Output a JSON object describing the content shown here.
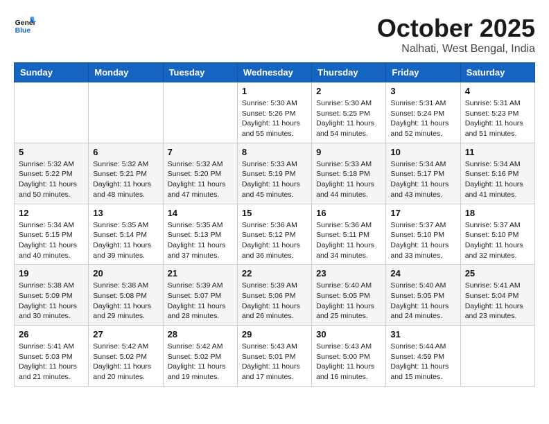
{
  "header": {
    "logo_line1": "General",
    "logo_line2": "Blue",
    "month": "October 2025",
    "location": "Nalhati, West Bengal, India"
  },
  "weekdays": [
    "Sunday",
    "Monday",
    "Tuesday",
    "Wednesday",
    "Thursday",
    "Friday",
    "Saturday"
  ],
  "weeks": [
    [
      {
        "day": "",
        "info": ""
      },
      {
        "day": "",
        "info": ""
      },
      {
        "day": "",
        "info": ""
      },
      {
        "day": "1",
        "info": "Sunrise: 5:30 AM\nSunset: 5:26 PM\nDaylight: 11 hours\nand 55 minutes."
      },
      {
        "day": "2",
        "info": "Sunrise: 5:30 AM\nSunset: 5:25 PM\nDaylight: 11 hours\nand 54 minutes."
      },
      {
        "day": "3",
        "info": "Sunrise: 5:31 AM\nSunset: 5:24 PM\nDaylight: 11 hours\nand 52 minutes."
      },
      {
        "day": "4",
        "info": "Sunrise: 5:31 AM\nSunset: 5:23 PM\nDaylight: 11 hours\nand 51 minutes."
      }
    ],
    [
      {
        "day": "5",
        "info": "Sunrise: 5:32 AM\nSunset: 5:22 PM\nDaylight: 11 hours\nand 50 minutes."
      },
      {
        "day": "6",
        "info": "Sunrise: 5:32 AM\nSunset: 5:21 PM\nDaylight: 11 hours\nand 48 minutes."
      },
      {
        "day": "7",
        "info": "Sunrise: 5:32 AM\nSunset: 5:20 PM\nDaylight: 11 hours\nand 47 minutes."
      },
      {
        "day": "8",
        "info": "Sunrise: 5:33 AM\nSunset: 5:19 PM\nDaylight: 11 hours\nand 45 minutes."
      },
      {
        "day": "9",
        "info": "Sunrise: 5:33 AM\nSunset: 5:18 PM\nDaylight: 11 hours\nand 44 minutes."
      },
      {
        "day": "10",
        "info": "Sunrise: 5:34 AM\nSunset: 5:17 PM\nDaylight: 11 hours\nand 43 minutes."
      },
      {
        "day": "11",
        "info": "Sunrise: 5:34 AM\nSunset: 5:16 PM\nDaylight: 11 hours\nand 41 minutes."
      }
    ],
    [
      {
        "day": "12",
        "info": "Sunrise: 5:34 AM\nSunset: 5:15 PM\nDaylight: 11 hours\nand 40 minutes."
      },
      {
        "day": "13",
        "info": "Sunrise: 5:35 AM\nSunset: 5:14 PM\nDaylight: 11 hours\nand 39 minutes."
      },
      {
        "day": "14",
        "info": "Sunrise: 5:35 AM\nSunset: 5:13 PM\nDaylight: 11 hours\nand 37 minutes."
      },
      {
        "day": "15",
        "info": "Sunrise: 5:36 AM\nSunset: 5:12 PM\nDaylight: 11 hours\nand 36 minutes."
      },
      {
        "day": "16",
        "info": "Sunrise: 5:36 AM\nSunset: 5:11 PM\nDaylight: 11 hours\nand 34 minutes."
      },
      {
        "day": "17",
        "info": "Sunrise: 5:37 AM\nSunset: 5:10 PM\nDaylight: 11 hours\nand 33 minutes."
      },
      {
        "day": "18",
        "info": "Sunrise: 5:37 AM\nSunset: 5:10 PM\nDaylight: 11 hours\nand 32 minutes."
      }
    ],
    [
      {
        "day": "19",
        "info": "Sunrise: 5:38 AM\nSunset: 5:09 PM\nDaylight: 11 hours\nand 30 minutes."
      },
      {
        "day": "20",
        "info": "Sunrise: 5:38 AM\nSunset: 5:08 PM\nDaylight: 11 hours\nand 29 minutes."
      },
      {
        "day": "21",
        "info": "Sunrise: 5:39 AM\nSunset: 5:07 PM\nDaylight: 11 hours\nand 28 minutes."
      },
      {
        "day": "22",
        "info": "Sunrise: 5:39 AM\nSunset: 5:06 PM\nDaylight: 11 hours\nand 26 minutes."
      },
      {
        "day": "23",
        "info": "Sunrise: 5:40 AM\nSunset: 5:05 PM\nDaylight: 11 hours\nand 25 minutes."
      },
      {
        "day": "24",
        "info": "Sunrise: 5:40 AM\nSunset: 5:05 PM\nDaylight: 11 hours\nand 24 minutes."
      },
      {
        "day": "25",
        "info": "Sunrise: 5:41 AM\nSunset: 5:04 PM\nDaylight: 11 hours\nand 23 minutes."
      }
    ],
    [
      {
        "day": "26",
        "info": "Sunrise: 5:41 AM\nSunset: 5:03 PM\nDaylight: 11 hours\nand 21 minutes."
      },
      {
        "day": "27",
        "info": "Sunrise: 5:42 AM\nSunset: 5:02 PM\nDaylight: 11 hours\nand 20 minutes."
      },
      {
        "day": "28",
        "info": "Sunrise: 5:42 AM\nSunset: 5:02 PM\nDaylight: 11 hours\nand 19 minutes."
      },
      {
        "day": "29",
        "info": "Sunrise: 5:43 AM\nSunset: 5:01 PM\nDaylight: 11 hours\nand 17 minutes."
      },
      {
        "day": "30",
        "info": "Sunrise: 5:43 AM\nSunset: 5:00 PM\nDaylight: 11 hours\nand 16 minutes."
      },
      {
        "day": "31",
        "info": "Sunrise: 5:44 AM\nSunset: 4:59 PM\nDaylight: 11 hours\nand 15 minutes."
      },
      {
        "day": "",
        "info": ""
      }
    ]
  ]
}
